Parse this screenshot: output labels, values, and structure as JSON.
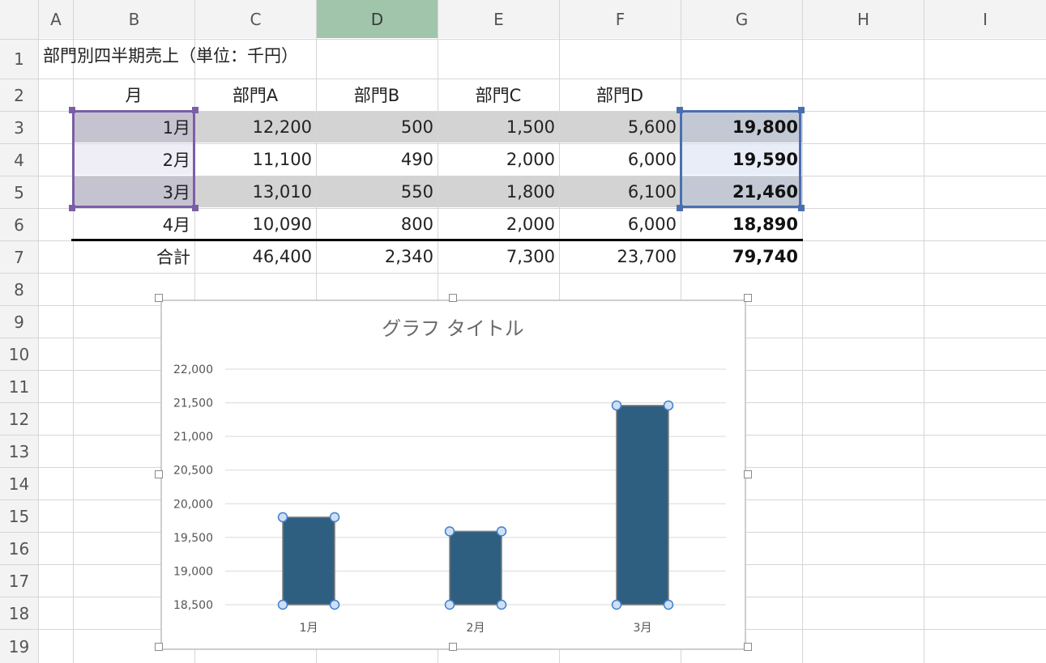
{
  "sheet": {
    "columns": [
      "A",
      "B",
      "C",
      "D",
      "E",
      "F",
      "G",
      "H",
      "I"
    ],
    "selected_column": "D",
    "rows": [
      "1",
      "2",
      "3",
      "4",
      "5",
      "6",
      "7",
      "8",
      "9",
      "10",
      "11",
      "12",
      "13",
      "14",
      "15",
      "16",
      "17",
      "18",
      "19"
    ]
  },
  "table": {
    "title": "部門別四半期売上（単位：千円）",
    "headers": [
      "月",
      "部門A",
      "部門B",
      "部門C",
      "部門D"
    ],
    "data": [
      [
        "1月",
        "12,200",
        "500",
        "1,500",
        "5,600",
        "19,800"
      ],
      [
        "2月",
        "11,100",
        "490",
        "2,000",
        "6,000",
        "19,590"
      ],
      [
        "3月",
        "13,010",
        "550",
        "1,800",
        "6,100",
        "21,460"
      ],
      [
        "4月",
        "10,090",
        "800",
        "2,000",
        "6,000",
        "18,890"
      ]
    ],
    "total": [
      "合計",
      "46,400",
      "2,340",
      "7,300",
      "23,700",
      "79,740"
    ]
  },
  "colors": {
    "category_highlight": "#7b5ea7",
    "value_highlight": "#4a6fb0",
    "band_fill": "#d3d3d3",
    "bar": "#2f5f80"
  },
  "chart_data": {
    "type": "bar",
    "title": "グラフ タイトル",
    "categories": [
      "1月",
      "2月",
      "3月"
    ],
    "values": [
      19800,
      19590,
      21460
    ],
    "ylim": [
      18500,
      22000
    ],
    "ytick_values": [
      18500,
      19000,
      19500,
      20000,
      20500,
      21000,
      21500,
      22000
    ],
    "ytick_labels": [
      "18,500",
      "19,000",
      "19,500",
      "20,000",
      "20,500",
      "21,000",
      "21,500",
      "22,000"
    ],
    "grid": true,
    "legend": "none"
  }
}
